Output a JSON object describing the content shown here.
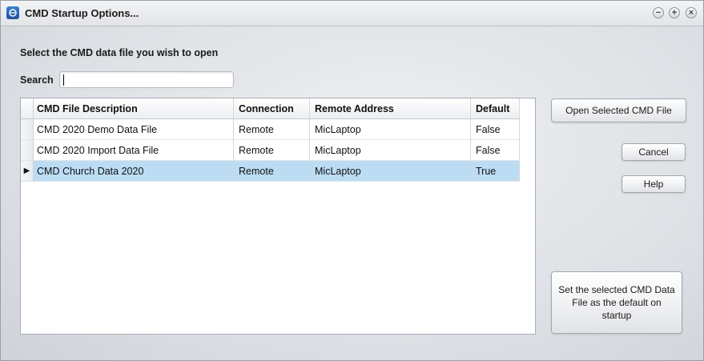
{
  "window": {
    "title": "CMD Startup Options..."
  },
  "prompt": "Select the CMD data file you wish to open",
  "search": {
    "label": "Search",
    "value": "",
    "placeholder": ""
  },
  "grid": {
    "columns": [
      "CMD File Description",
      "Connection",
      "Remote Address",
      "Default"
    ],
    "rows": [
      {
        "description": "CMD 2020 Demo Data File",
        "connection": "Remote",
        "remote_address": "MicLaptop",
        "default": "False",
        "current": false
      },
      {
        "description": "CMD 2020 Import Data File",
        "connection": "Remote",
        "remote_address": "MicLaptop",
        "default": "False",
        "current": false
      },
      {
        "description": "CMD Church Data 2020",
        "connection": "Remote",
        "remote_address": "MicLaptop",
        "default": "True",
        "current": true
      }
    ],
    "current_row_marker": "▶"
  },
  "buttons": {
    "open": "Open Selected CMD File",
    "cancel": "Cancel",
    "help": "Help",
    "set_default": "Set the selected CMD Data File as the default on startup"
  },
  "window_controls": {
    "minimize": "−",
    "maximize": "+",
    "close": "×"
  },
  "colors": {
    "selection": "#bcdcf4",
    "accent": "#2a64b8"
  }
}
